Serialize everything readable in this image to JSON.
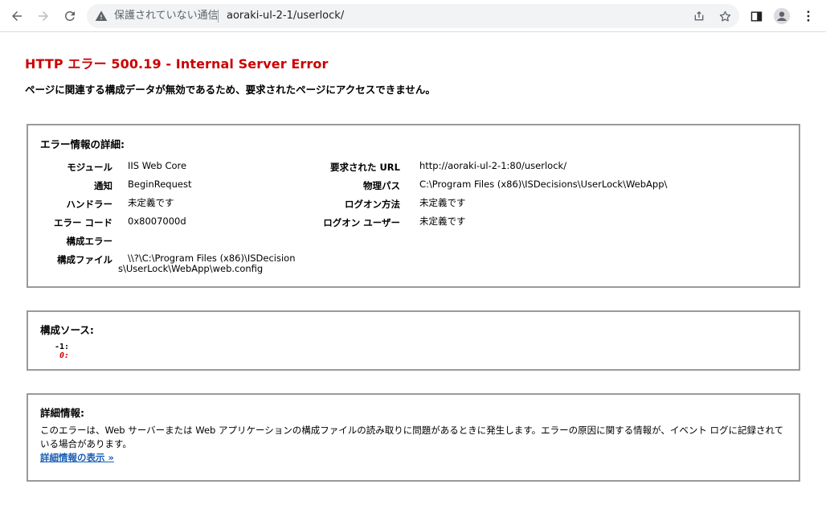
{
  "browser": {
    "status_text": "保護されていない通信",
    "url": "aoraki-ul-2-1/userlock/"
  },
  "page": {
    "title": "HTTP エラー 500.19 - Internal Server Error",
    "subtitle": "ページに関連する構成データが無効であるため、要求されたページにアクセスできません。"
  },
  "error_info": {
    "heading": "エラー情報の詳細:",
    "left": [
      {
        "label": "モジュール",
        "value": "IIS Web Core"
      },
      {
        "label": "通知",
        "value": "BeginRequest"
      },
      {
        "label": "ハンドラー",
        "value": "未定義です"
      },
      {
        "label": "エラー コード",
        "value": "0x8007000d"
      },
      {
        "label": "構成エラー",
        "value": ""
      },
      {
        "label": "構成ファイル",
        "value_line1": "\\\\?\\C:\\Program Files (x86)\\ISDecision",
        "value_line2": "s\\UserLock\\WebApp\\web.config"
      }
    ],
    "right": [
      {
        "label": "要求された URL",
        "value": "http://aoraki-ul-2-1:80/userlock/"
      },
      {
        "label": "物理パス",
        "value": "C:\\Program Files (x86)\\ISDecisions\\UserLock\\WebApp\\"
      },
      {
        "label": "ログオン方法",
        "value": "未定義です"
      },
      {
        "label": "ログオン ユーザー",
        "value": "未定義です"
      }
    ]
  },
  "config_source": {
    "heading": "構成ソース:",
    "line1": "-1:",
    "line2": "0:"
  },
  "more_info": {
    "heading": "詳細情報:",
    "description": "このエラーは、Web サーバーまたは Web アプリケーションの構成ファイルの読み取りに問題があるときに発生します。エラーの原因に関する情報が、イベント ログに記録されている場合があります。",
    "link": "詳細情報の表示 »"
  }
}
